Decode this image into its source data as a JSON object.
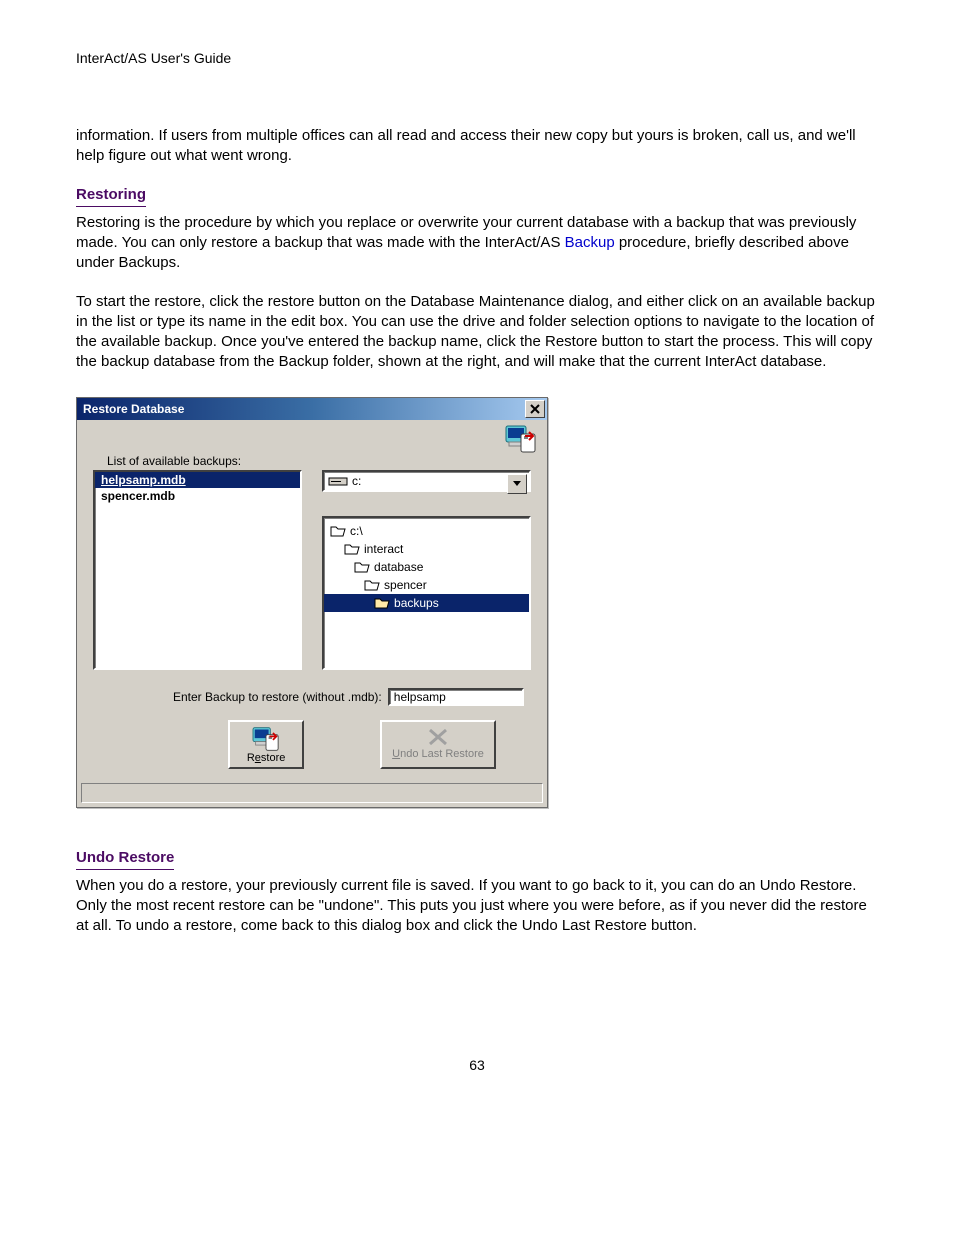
{
  "page": {
    "header": "InterAct/AS User's Guide",
    "page_number": "63"
  },
  "text": {
    "p1": "information. If users from multiple offices can all read and access their new copy but yours is broken, call us, and we'll help figure out what went wrong.",
    "restoring_label": "Restoring",
    "p2_1": "Restoring is the procedure by which you replace or overwrite your current database with a backup that was previously made. You can only restore a backup that was made with the InterAct/AS ",
    "p2_backup_link": "Backup",
    "p2_2": " procedure, briefly described above under Backups.",
    "p3": "To start the restore, click the restore button on the Database Maintenance dialog, and either click on an available backup in the list or type its name in the edit box. You can use the drive and folder selection options to navigate to the location of the available backup. Once you've entered the backup name, click the Restore button to start the process. This will copy the backup database from the Backup folder, shown at the right, and will make that the current InterAct database.",
    "undo_restore_label": "Undo Restore",
    "p4": "When you do a restore, your previously current file is saved. If you want to go back to it, you can do an Undo Restore. Only the most recent restore can be \"undone\". This puts you just where you were before, as if you never did the restore at all. To undo a restore, come back to this dialog box and click the Undo Last Restore button."
  },
  "dialog": {
    "title": "Restore Database",
    "list_label": "List of available backups:",
    "backups": [
      {
        "name": "helpsamp.mdb",
        "selected": true
      },
      {
        "name": "spencer.mdb",
        "selected": false
      }
    ],
    "drive": "c:",
    "tree": [
      {
        "label": "c:\\",
        "indent": 0,
        "selected": false
      },
      {
        "label": "interact",
        "indent": 1,
        "selected": false
      },
      {
        "label": "database",
        "indent": 2,
        "selected": false
      },
      {
        "label": "spencer",
        "indent": 3,
        "selected": false
      },
      {
        "label": "backups",
        "indent": 4,
        "selected": true
      }
    ],
    "enter_label": "Enter Backup to restore (without .mdb):",
    "enter_value": "helpsamp",
    "restore_btn": {
      "pre": "R",
      "u": "e",
      "post": "store"
    },
    "undo_btn": {
      "pre": "",
      "u": "U",
      "post": "ndo Last Restore"
    }
  }
}
